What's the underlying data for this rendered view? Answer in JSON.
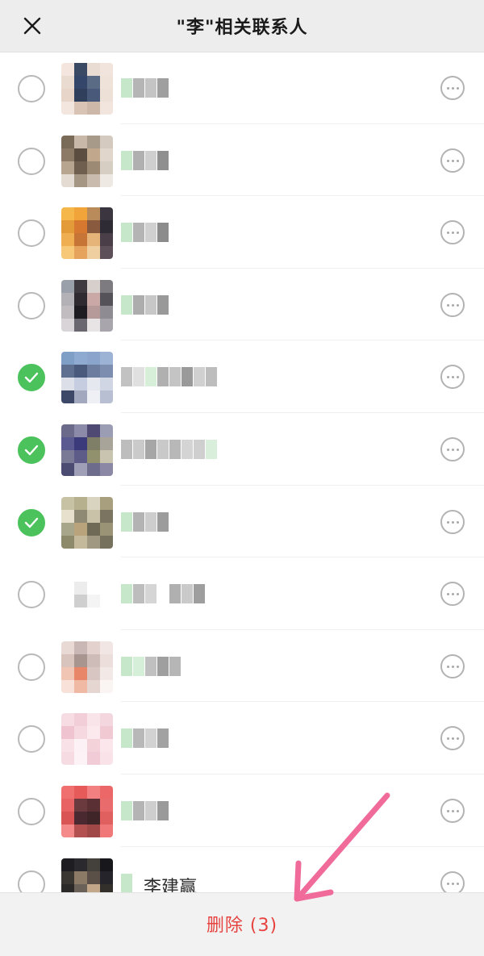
{
  "header": {
    "title": "\"李\"相关联系人"
  },
  "icons": {
    "close": "close-icon",
    "more": "more-options-icon",
    "check": "check-icon"
  },
  "colors": {
    "accent_green": "#4cc25d",
    "delete_red": "#e64340",
    "annotation_arrow": "#f06a9a"
  },
  "contacts": [
    {
      "checked": false,
      "name": "",
      "avatar": [
        "#f4e6de",
        "#3a4a65",
        "#e9dcd3",
        "#f0e4dc",
        "#eadbd1",
        "#34476a",
        "#5a6b85",
        "#efe2d9",
        "#e7d5ca",
        "#2f3f5c",
        "#48597a",
        "#ede0d7",
        "#f2e6de",
        "#d8c3b5",
        "#cdb7a8",
        "#f1e5dd"
      ],
      "name_blocks": [
        "#c6e7c9",
        "#b5b5b5",
        "#c4c4c4",
        "#9f9f9f"
      ]
    },
    {
      "checked": false,
      "name": "",
      "avatar": [
        "#7a6a58",
        "#c7b8a8",
        "#a89a88",
        "#d4cabf",
        "#8d7a66",
        "#5b4d3f",
        "#c1a88c",
        "#e0d6cc",
        "#b7a590",
        "#6f5f4f",
        "#9c8a75",
        "#d6cdc3",
        "#e4dcd3",
        "#a59684",
        "#c9bcae",
        "#efe9e3"
      ],
      "name_blocks": [
        "#c6e7c9",
        "#b0b0b0",
        "#cfcfcf",
        "#8f8f8f"
      ]
    },
    {
      "checked": false,
      "name": "",
      "avatar": [
        "#f5b74a",
        "#f1a43a",
        "#b98a5a",
        "#3b3540",
        "#e39a38",
        "#d6782f",
        "#8a5a3f",
        "#2f2b35",
        "#f0ae52",
        "#c77437",
        "#e6b478",
        "#4a3f48",
        "#f7c878",
        "#e5a35d",
        "#efcf9f",
        "#5d5058"
      ],
      "name_blocks": [
        "#c6e7c9",
        "#b4b4b4",
        "#d0d0d0",
        "#8c8c8c"
      ]
    },
    {
      "checked": false,
      "name": "",
      "avatar": [
        "#9aa0aa",
        "#3e3a3f",
        "#d7cfcb",
        "#7d7a80",
        "#b3b1b6",
        "#2e2a2f",
        "#caa8a6",
        "#56525a",
        "#c1bcc0",
        "#1f1c21",
        "#b59a99",
        "#8e8b92",
        "#d8d4d7",
        "#6b6770",
        "#e8e3e5",
        "#a9a5ac"
      ],
      "name_blocks": [
        "#c6e7c9",
        "#adadad",
        "#c7c7c7",
        "#999999"
      ]
    },
    {
      "checked": true,
      "name": "",
      "avatar": [
        "#7f9fc7",
        "#8faad0",
        "#8aa4cb",
        "#9db3d6",
        "#5f6f8f",
        "#4a5a7c",
        "#6c7da0",
        "#7c8db0",
        "#dcdfe8",
        "#c7cde0",
        "#e6e8ef",
        "#d1d6e5",
        "#3d4868",
        "#a2a8bd",
        "#eef0f5",
        "#b9bfd2"
      ],
      "name_blocks": [
        "#c2c2c2",
        "#e0e0e0",
        "#d7efd9",
        "#b0b0b0",
        "#c4c4c4",
        "#9a9a9a",
        "#d0d0d0",
        "#bdbdbd"
      ]
    },
    {
      "checked": true,
      "name": "",
      "avatar": [
        "#6b6a8a",
        "#8b8aa8",
        "#4e4a74",
        "#9b9db4",
        "#5a5a90",
        "#3b3a7a",
        "#7f7e66",
        "#a8a49a",
        "#7a7a96",
        "#5d5c88",
        "#92916e",
        "#c9c4b0",
        "#4c4b72",
        "#a09fb8",
        "#6e6c8c",
        "#8a88a4"
      ],
      "name_blocks": [
        "#bdbdbd",
        "#cacaca",
        "#a6a6a6",
        "#c9c9c9",
        "#b8b8b8",
        "#d4d4d4",
        "#cfcfcf",
        "#d9efdc"
      ]
    },
    {
      "checked": true,
      "name": "",
      "avatar": [
        "#c8c2a5",
        "#b7b08f",
        "#d9d4bf",
        "#a89f7e",
        "#e6e0cd",
        "#8e8a74",
        "#c9c1a8",
        "#7a7460",
        "#a7a58a",
        "#b8a37c",
        "#6f6a55",
        "#9a9376",
        "#8d8a6c",
        "#c5b99b",
        "#a09880",
        "#76715c"
      ],
      "name_blocks": [
        "#c6e7c9",
        "#b3b3b3",
        "#cdcdcd",
        "#9c9c9c"
      ]
    },
    {
      "checked": false,
      "name": "",
      "avatar": [
        "#ffffff",
        "#ffffff",
        "#ffffff",
        "#ffffff",
        "#ffffff",
        "#ececec",
        "#ffffff",
        "#ffffff",
        "#ffffff",
        "#cfcfcf",
        "#f4f4f4",
        "#ffffff",
        "#ffffff",
        "#ffffff",
        "#ffffff",
        "#ffffff"
      ],
      "name_blocks": [
        "#c6e7c9",
        "#bdbdbd",
        "#d5d5d5",
        "#ffffff",
        "#b0b0b0",
        "#cacaca",
        "#9e9e9e"
      ]
    },
    {
      "checked": false,
      "name": "",
      "avatar": [
        "#e9d9d5",
        "#c8b7b4",
        "#e2d1cd",
        "#f1e6e3",
        "#d9c3bd",
        "#a8958f",
        "#cdbcb7",
        "#ebdedb",
        "#f0c5b3",
        "#e8866a",
        "#d7c6c1",
        "#f2e8e5",
        "#f7e1d9",
        "#efb9a4",
        "#e5d6d2",
        "#faf4f2"
      ],
      "name_blocks": [
        "#c6e7c9",
        "#d6efd8",
        "#c0c0c0",
        "#9f9f9f",
        "#b6b6b6"
      ]
    },
    {
      "checked": false,
      "name": "",
      "avatar": [
        "#f7dde3",
        "#f2cfd8",
        "#f9e4e9",
        "#f4d6de",
        "#efc3cf",
        "#f5d8e0",
        "#fbe9ee",
        "#f0c9d3",
        "#f8e1e7",
        "#fcf1f4",
        "#f3d2da",
        "#fae6eb",
        "#f6dbe2",
        "#fdf3f6",
        "#f1ccd6",
        "#f9e3e9"
      ],
      "name_blocks": [
        "#c6e7c9",
        "#b8b8b8",
        "#d2d2d2",
        "#a2a2a2"
      ]
    },
    {
      "checked": false,
      "name": "",
      "avatar": [
        "#f07070",
        "#e65a5a",
        "#f28080",
        "#ec6868",
        "#e86363",
        "#6a3a3e",
        "#5a3035",
        "#ea6b6b",
        "#d95555",
        "#4a2a30",
        "#3f2428",
        "#e06060",
        "#f48a8a",
        "#b35050",
        "#a04848",
        "#f07878"
      ],
      "name_blocks": [
        "#c6e7c9",
        "#b4b4b4",
        "#cecece",
        "#9a9a9a"
      ]
    },
    {
      "checked": false,
      "name": "李建赢",
      "avatar": [
        "#1e1e22",
        "#2a2a2e",
        "#44403c",
        "#18181c",
        "#3a3632",
        "#8a7a66",
        "#5a5048",
        "#24242a",
        "#2c2a28",
        "#6a6258",
        "#c2a888",
        "#33302c",
        "#141418",
        "#3e3a36",
        "#7a6e60",
        "#222226"
      ],
      "name_blocks": [
        "#c6e7c9"
      ]
    }
  ],
  "footer": {
    "delete_label": "删除 (3)"
  }
}
